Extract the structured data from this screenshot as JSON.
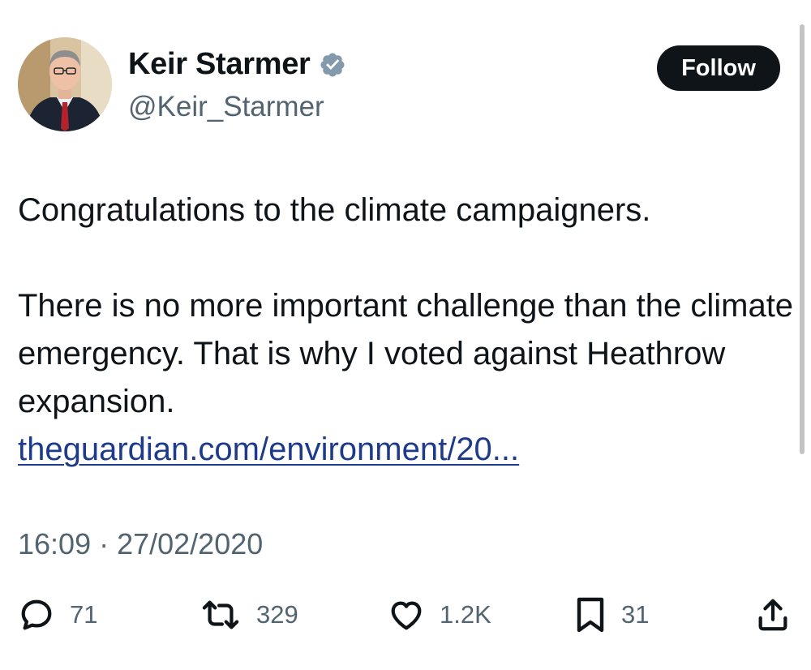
{
  "author": {
    "display_name": "Keir Starmer",
    "handle": "@Keir_Starmer",
    "verified": true
  },
  "follow_label": "Follow",
  "tweet": {
    "line1": "Congratulations to the climate campaigners.",
    "line2": "There is no more important challenge than the climate emergency. That is why I voted against Heathrow expansion.",
    "link": "theguardian.com/environment/20..."
  },
  "timestamp": "16:09 · 27/02/2020",
  "actions": {
    "replies": "71",
    "retweets": "329",
    "likes": "1.2K",
    "bookmarks": "31"
  },
  "colors": {
    "text": "#0f1419",
    "secondary": "#536471",
    "link": "#1d3b8a",
    "verified_badge": "#829aab"
  },
  "icons": [
    "verified-badge-icon",
    "reply-icon",
    "retweet-icon",
    "like-icon",
    "bookmark-icon",
    "share-icon"
  ]
}
